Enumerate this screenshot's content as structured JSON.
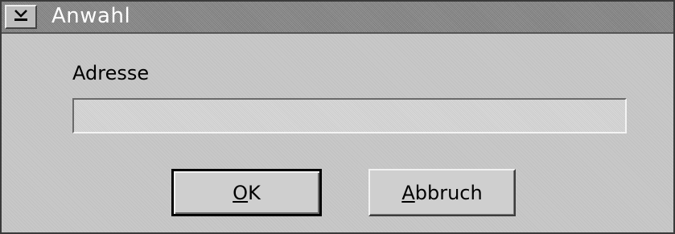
{
  "window": {
    "title": "Anwahl"
  },
  "form": {
    "address_label": "Adresse",
    "address_value": "",
    "address_placeholder": ""
  },
  "buttons": {
    "ok": {
      "mnemonic": "O",
      "rest": "K"
    },
    "cancel": {
      "mnemonic": "A",
      "rest": "bbruch"
    }
  },
  "icons": {
    "system_menu": "system-menu-icon"
  },
  "colors": {
    "dialog_background": "#c8c8c8",
    "titlebar": "#8e8e8e",
    "title_text": "#ffffff"
  }
}
